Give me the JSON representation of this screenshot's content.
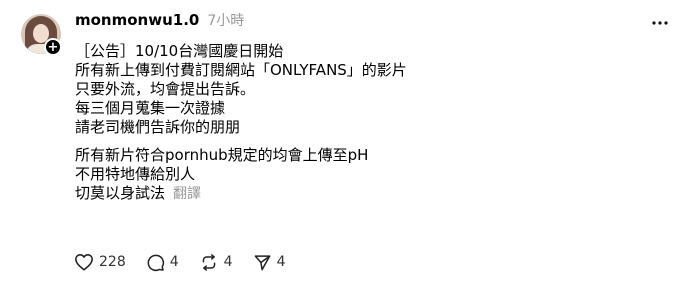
{
  "post": {
    "username": "monmonwu1.0",
    "timestamp": "7小時",
    "lines_block1": [
      "［公告］10/10台灣國慶日開始",
      "所有新上傳到付費訂閱網站「ONLYFANS」的影片",
      "只要外流，均會提出告訴。",
      "每三個月蒐集一次證據",
      "請老司機們告訴你的朋朋"
    ],
    "lines_block2": [
      "所有新片符合pornhub規定的均會上傳至pH",
      "不用特地傳給別人",
      "切莫以身試法"
    ],
    "translate_label": "翻譯"
  },
  "actions": {
    "like_count": "228",
    "reply_count": "4",
    "repost_count": "4",
    "share_count": "4"
  },
  "icons": {
    "more": "more-horizontal-icon",
    "like": "heart-icon",
    "reply": "comment-bubble-icon",
    "repost": "repost-icon",
    "share": "send-icon",
    "follow": "plus-icon"
  },
  "colors": {
    "text": "#000000",
    "muted": "#999999",
    "background": "#ffffff"
  }
}
